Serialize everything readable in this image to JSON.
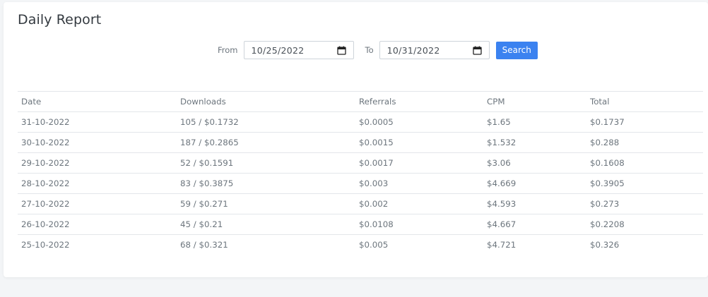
{
  "page": {
    "title": "Daily Report"
  },
  "filters": {
    "from_label": "From",
    "from_value": "10/25/2022",
    "to_label": "To",
    "to_value": "10/31/2022",
    "search_label": "Search",
    "calendar_icon": "calendar-icon"
  },
  "colors": {
    "accent": "#3b82f0",
    "title": "#343a40",
    "text": "#6c757d",
    "border": "#e3e6ea"
  },
  "table": {
    "headers": [
      "Date",
      "Downloads",
      "Referrals",
      "CPM",
      "Total"
    ],
    "rows": [
      [
        "31-10-2022",
        "105 / $0.1732",
        "$0.0005",
        "$1.65",
        "$0.1737"
      ],
      [
        "30-10-2022",
        "187 / $0.2865",
        "$0.0015",
        "$1.532",
        "$0.288"
      ],
      [
        "29-10-2022",
        "52 / $0.1591",
        "$0.0017",
        "$3.06",
        "$0.1608"
      ],
      [
        "28-10-2022",
        "83 / $0.3875",
        "$0.003",
        "$4.669",
        "$0.3905"
      ],
      [
        "27-10-2022",
        "59 / $0.271",
        "$0.002",
        "$4.593",
        "$0.273"
      ],
      [
        "26-10-2022",
        "45 / $0.21",
        "$0.0108",
        "$4.667",
        "$0.2208"
      ],
      [
        "25-10-2022",
        "68 / $0.321",
        "$0.005",
        "$4.721",
        "$0.326"
      ]
    ]
  }
}
